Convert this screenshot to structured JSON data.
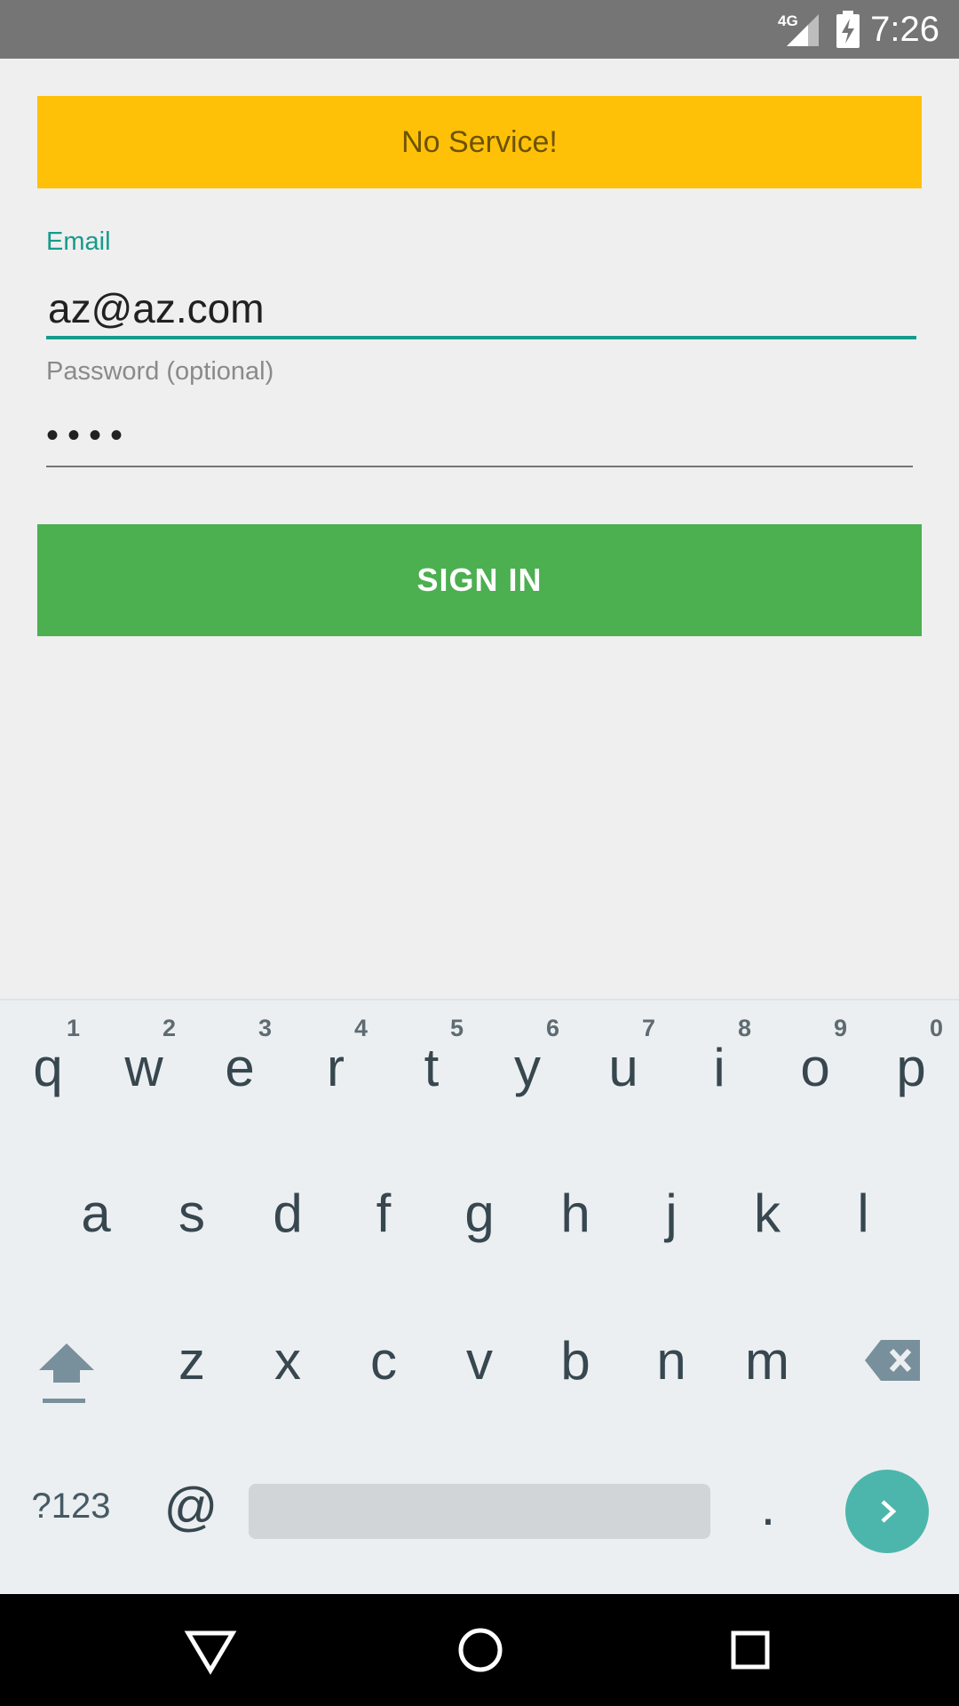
{
  "status_bar": {
    "network": "4G",
    "time": "7:26",
    "icons": [
      "signal-icon",
      "battery-charging-icon"
    ]
  },
  "banner": {
    "text": "No Service!",
    "color": "#ffc107"
  },
  "email": {
    "label": "Email",
    "value": "az@az.com",
    "accent": "#169b8c"
  },
  "password": {
    "label": "Password (optional)",
    "masked_value": "••••"
  },
  "sign_in": {
    "label": "SIGN IN",
    "color": "#4caf50"
  },
  "keyboard": {
    "row1": [
      {
        "letter": "q",
        "hint": "1"
      },
      {
        "letter": "w",
        "hint": "2"
      },
      {
        "letter": "e",
        "hint": "3"
      },
      {
        "letter": "r",
        "hint": "4"
      },
      {
        "letter": "t",
        "hint": "5"
      },
      {
        "letter": "y",
        "hint": "6"
      },
      {
        "letter": "u",
        "hint": "7"
      },
      {
        "letter": "i",
        "hint": "8"
      },
      {
        "letter": "o",
        "hint": "9"
      },
      {
        "letter": "p",
        "hint": "0"
      }
    ],
    "row2": [
      "a",
      "s",
      "d",
      "f",
      "g",
      "h",
      "j",
      "k",
      "l"
    ],
    "row3": [
      "z",
      "x",
      "c",
      "v",
      "b",
      "n",
      "m"
    ],
    "symbols_label": "?123",
    "at_label": "@",
    "period_label": ".",
    "icons": [
      "shift-icon",
      "backspace-icon",
      "next-arrow-icon"
    ]
  },
  "nav_bar": {
    "icons": [
      "back-icon",
      "home-icon",
      "recents-icon"
    ]
  }
}
